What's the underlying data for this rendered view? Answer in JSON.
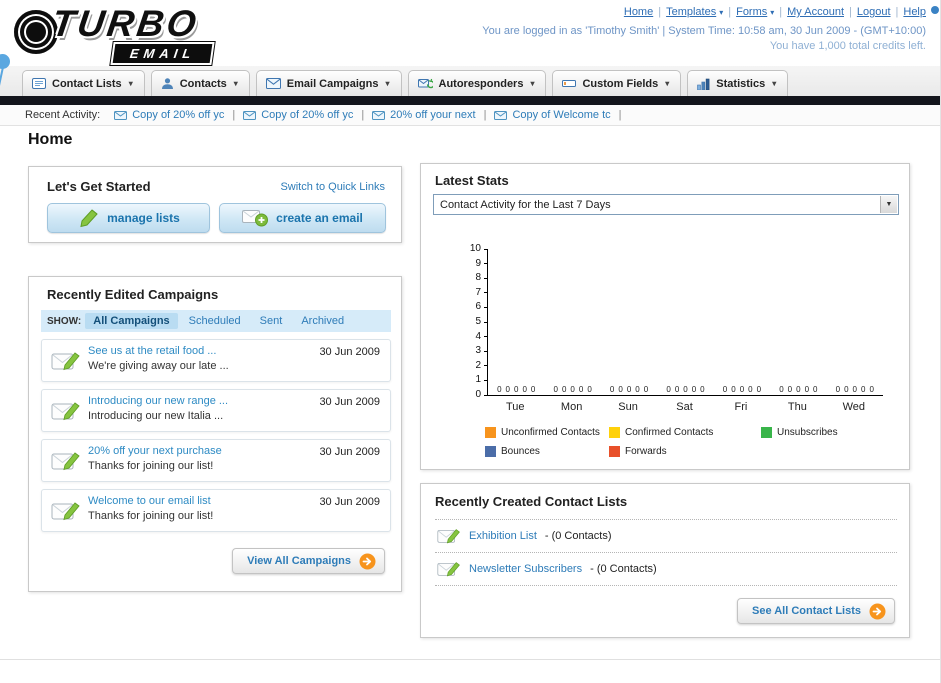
{
  "page_title": "Home",
  "header": {
    "logo_title": "TURBO",
    "logo_subtitle": "EMAIL",
    "nav_links": [
      {
        "label": "Home",
        "dropdown": false
      },
      {
        "label": "Templates",
        "dropdown": true
      },
      {
        "label": "Forms",
        "dropdown": true
      },
      {
        "label": "My Account",
        "dropdown": false
      },
      {
        "label": "Logout",
        "dropdown": false
      },
      {
        "label": "Help",
        "dropdown": false
      }
    ],
    "login_info": "You are logged in as 'Timothy Smith' | System Time: 10:58 am, 30 Jun 2009 - (GMT+10:00)",
    "credits_info": "You have 1,000 total credits left."
  },
  "main_nav": {
    "tabs": [
      {
        "label": "Contact Lists",
        "icon": "contact-lists-icon"
      },
      {
        "label": "Contacts",
        "icon": "contacts-icon"
      },
      {
        "label": "Email Campaigns",
        "icon": "email-campaigns-icon"
      },
      {
        "label": "Autoresponders",
        "icon": "autoresponders-icon"
      },
      {
        "label": "Custom Fields",
        "icon": "custom-fields-icon"
      },
      {
        "label": "Statistics",
        "icon": "statistics-icon"
      }
    ]
  },
  "recent_activity": {
    "label": "Recent Activity:",
    "items": [
      {
        "label": "Copy of 20% off yc",
        "icon": "envelope-icon"
      },
      {
        "label": "Copy of 20% off yc",
        "icon": "envelope-icon"
      },
      {
        "label": "20% off your next",
        "icon": "envelope-icon"
      },
      {
        "label": "Copy of Welcome tc",
        "icon": "envelope-icon"
      }
    ]
  },
  "get_started": {
    "title": "Let's Get Started",
    "switch_link": "Switch to Quick Links",
    "manage_lists_label": "manage lists",
    "create_email_label": "create an email"
  },
  "campaigns": {
    "title": "Recently Edited Campaigns",
    "show_label": "SHOW:",
    "filters": [
      {
        "label": "All Campaigns",
        "selected": true
      },
      {
        "label": "Scheduled",
        "selected": false
      },
      {
        "label": "Sent",
        "selected": false
      },
      {
        "label": "Archived",
        "selected": false
      }
    ],
    "items": [
      {
        "title": "See us at the retail food ...",
        "subtitle": "We're giving away our late ...",
        "date": "30 Jun 2009"
      },
      {
        "title": "Introducing our new range ...",
        "subtitle": "Introducing our new Italia ...",
        "date": "30 Jun 2009"
      },
      {
        "title": "20% off your next purchase",
        "subtitle": "Thanks for joining our list!",
        "date": "30 Jun 2009"
      },
      {
        "title": "Welcome to our email list",
        "subtitle": "Thanks for joining our list!",
        "date": "30 Jun 2009"
      }
    ],
    "view_all_label": "View All Campaigns"
  },
  "latest_stats": {
    "title": "Latest Stats",
    "selector_value": "Contact Activity for the Last 7 Days"
  },
  "chart_data": {
    "type": "bar",
    "title": "Contact Activity for the Last 7 Days",
    "categories": [
      "Tue",
      "Mon",
      "Sun",
      "Sat",
      "Fri",
      "Thu",
      "Wed"
    ],
    "series": [
      {
        "name": "Unconfirmed Contacts",
        "color": "#f7941d",
        "values": [
          0,
          0,
          0,
          0,
          0,
          0,
          0
        ]
      },
      {
        "name": "Confirmed Contacts",
        "color": "#ffd10a",
        "values": [
          0,
          0,
          0,
          0,
          0,
          0,
          0
        ]
      },
      {
        "name": "Unsubscribes",
        "color": "#39b54a",
        "values": [
          0,
          0,
          0,
          0,
          0,
          0,
          0
        ]
      },
      {
        "name": "Bounces",
        "color": "#4b6da8",
        "values": [
          0,
          0,
          0,
          0,
          0,
          0,
          0
        ]
      },
      {
        "name": "Forwards",
        "color": "#e8502a",
        "values": [
          0,
          0,
          0,
          0,
          0,
          0,
          0
        ]
      }
    ],
    "ylim": [
      0,
      10
    ],
    "ytick_step": 1,
    "grid": false,
    "legend_position": "bottom",
    "show_zero_value_labels": true
  },
  "contact_lists": {
    "title": "Recently Created Contact Lists",
    "items": [
      {
        "name": "Exhibition List",
        "detail": "- (0 Contacts)"
      },
      {
        "name": "Newsletter Subscribers",
        "detail": "- (0 Contacts)"
      }
    ],
    "see_all_label": "See All Contact Lists"
  }
}
